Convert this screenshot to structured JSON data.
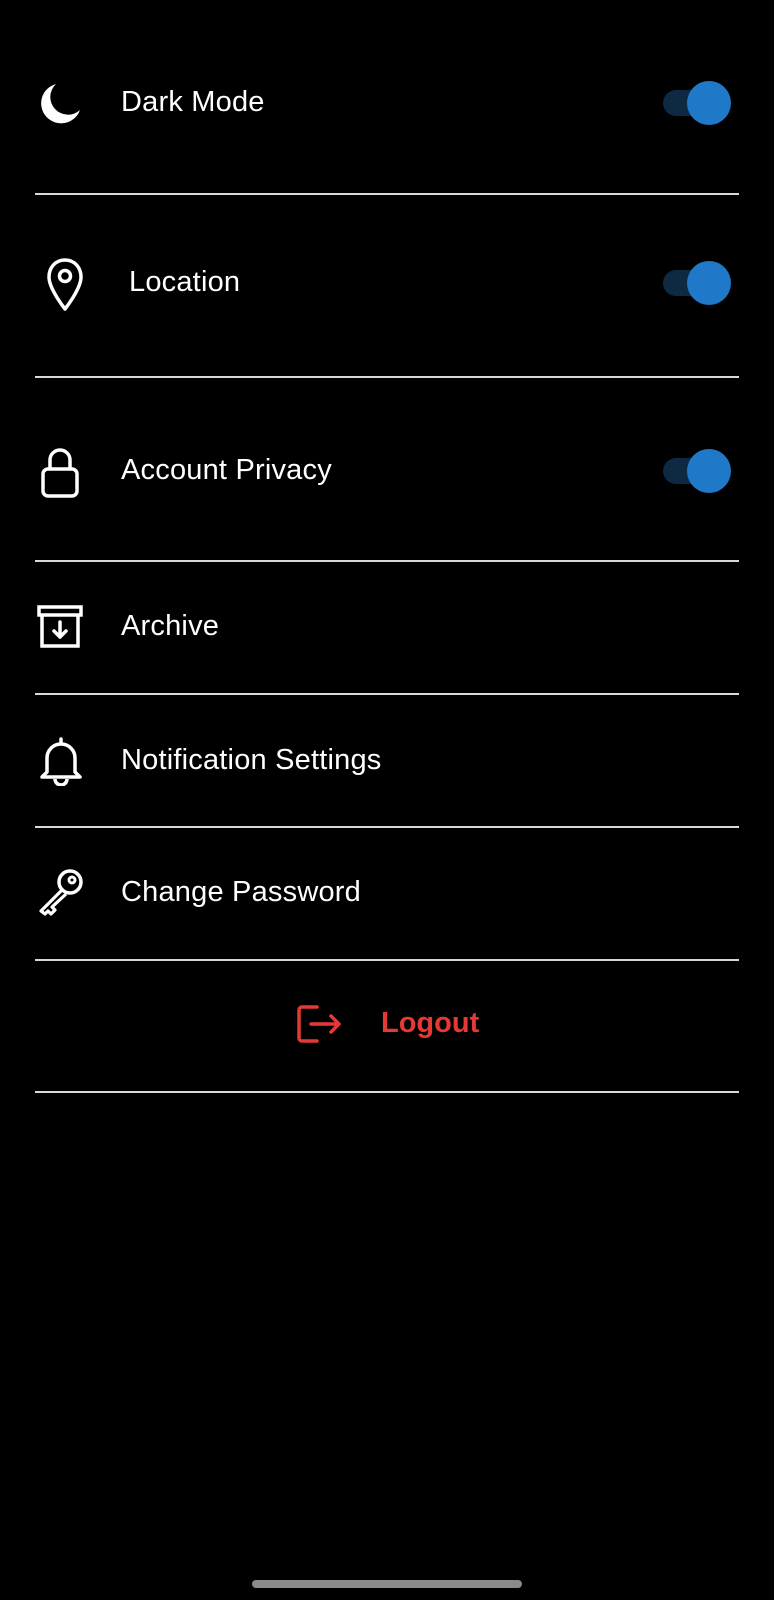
{
  "settings": {
    "items": [
      {
        "id": "dark-mode",
        "label": "Dark Mode",
        "icon": "moon-icon",
        "toggle": true,
        "enabled": true
      },
      {
        "id": "location",
        "label": "Location",
        "icon": "location-pin-icon",
        "toggle": true,
        "enabled": true
      },
      {
        "id": "account-privacy",
        "label": "Account Privacy",
        "icon": "lock-icon",
        "toggle": true,
        "enabled": true
      },
      {
        "id": "archive",
        "label": "Archive",
        "icon": "archive-icon",
        "toggle": false
      },
      {
        "id": "notification-settings",
        "label": "Notification Settings",
        "icon": "bell-icon",
        "toggle": false
      },
      {
        "id": "change-password",
        "label": "Change Password",
        "icon": "key-icon",
        "toggle": false
      }
    ],
    "logout": {
      "label": "Logout",
      "icon": "logout-icon"
    }
  },
  "colors": {
    "background": "#000000",
    "text": "#ffffff",
    "divider": "#d8d8d8",
    "toggle_knob": "#1f78c8",
    "toggle_track": "#0e2a42",
    "logout": "#e53935"
  }
}
